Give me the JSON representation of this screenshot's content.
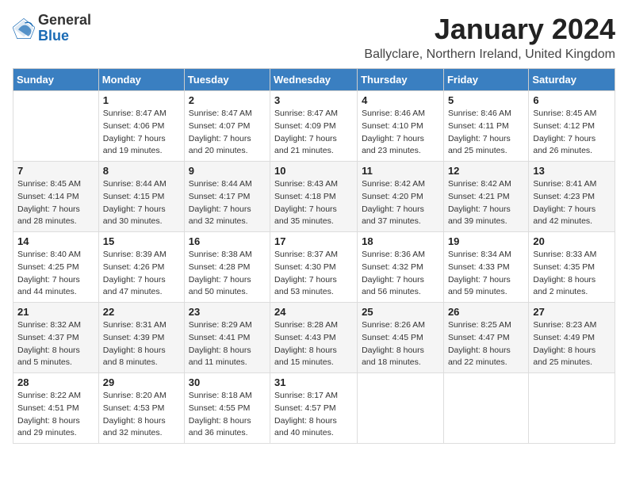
{
  "header": {
    "logo_general": "General",
    "logo_blue": "Blue",
    "month_title": "January 2024",
    "location": "Ballyclare, Northern Ireland, United Kingdom"
  },
  "weekdays": [
    "Sunday",
    "Monday",
    "Tuesday",
    "Wednesday",
    "Thursday",
    "Friday",
    "Saturday"
  ],
  "weeks": [
    [
      {
        "day": "",
        "info": ""
      },
      {
        "day": "1",
        "info": "Sunrise: 8:47 AM\nSunset: 4:06 PM\nDaylight: 7 hours\nand 19 minutes."
      },
      {
        "day": "2",
        "info": "Sunrise: 8:47 AM\nSunset: 4:07 PM\nDaylight: 7 hours\nand 20 minutes."
      },
      {
        "day": "3",
        "info": "Sunrise: 8:47 AM\nSunset: 4:09 PM\nDaylight: 7 hours\nand 21 minutes."
      },
      {
        "day": "4",
        "info": "Sunrise: 8:46 AM\nSunset: 4:10 PM\nDaylight: 7 hours\nand 23 minutes."
      },
      {
        "day": "5",
        "info": "Sunrise: 8:46 AM\nSunset: 4:11 PM\nDaylight: 7 hours\nand 25 minutes."
      },
      {
        "day": "6",
        "info": "Sunrise: 8:45 AM\nSunset: 4:12 PM\nDaylight: 7 hours\nand 26 minutes."
      }
    ],
    [
      {
        "day": "7",
        "info": "Sunrise: 8:45 AM\nSunset: 4:14 PM\nDaylight: 7 hours\nand 28 minutes."
      },
      {
        "day": "8",
        "info": "Sunrise: 8:44 AM\nSunset: 4:15 PM\nDaylight: 7 hours\nand 30 minutes."
      },
      {
        "day": "9",
        "info": "Sunrise: 8:44 AM\nSunset: 4:17 PM\nDaylight: 7 hours\nand 32 minutes."
      },
      {
        "day": "10",
        "info": "Sunrise: 8:43 AM\nSunset: 4:18 PM\nDaylight: 7 hours\nand 35 minutes."
      },
      {
        "day": "11",
        "info": "Sunrise: 8:42 AM\nSunset: 4:20 PM\nDaylight: 7 hours\nand 37 minutes."
      },
      {
        "day": "12",
        "info": "Sunrise: 8:42 AM\nSunset: 4:21 PM\nDaylight: 7 hours\nand 39 minutes."
      },
      {
        "day": "13",
        "info": "Sunrise: 8:41 AM\nSunset: 4:23 PM\nDaylight: 7 hours\nand 42 minutes."
      }
    ],
    [
      {
        "day": "14",
        "info": "Sunrise: 8:40 AM\nSunset: 4:25 PM\nDaylight: 7 hours\nand 44 minutes."
      },
      {
        "day": "15",
        "info": "Sunrise: 8:39 AM\nSunset: 4:26 PM\nDaylight: 7 hours\nand 47 minutes."
      },
      {
        "day": "16",
        "info": "Sunrise: 8:38 AM\nSunset: 4:28 PM\nDaylight: 7 hours\nand 50 minutes."
      },
      {
        "day": "17",
        "info": "Sunrise: 8:37 AM\nSunset: 4:30 PM\nDaylight: 7 hours\nand 53 minutes."
      },
      {
        "day": "18",
        "info": "Sunrise: 8:36 AM\nSunset: 4:32 PM\nDaylight: 7 hours\nand 56 minutes."
      },
      {
        "day": "19",
        "info": "Sunrise: 8:34 AM\nSunset: 4:33 PM\nDaylight: 7 hours\nand 59 minutes."
      },
      {
        "day": "20",
        "info": "Sunrise: 8:33 AM\nSunset: 4:35 PM\nDaylight: 8 hours\nand 2 minutes."
      }
    ],
    [
      {
        "day": "21",
        "info": "Sunrise: 8:32 AM\nSunset: 4:37 PM\nDaylight: 8 hours\nand 5 minutes."
      },
      {
        "day": "22",
        "info": "Sunrise: 8:31 AM\nSunset: 4:39 PM\nDaylight: 8 hours\nand 8 minutes."
      },
      {
        "day": "23",
        "info": "Sunrise: 8:29 AM\nSunset: 4:41 PM\nDaylight: 8 hours\nand 11 minutes."
      },
      {
        "day": "24",
        "info": "Sunrise: 8:28 AM\nSunset: 4:43 PM\nDaylight: 8 hours\nand 15 minutes."
      },
      {
        "day": "25",
        "info": "Sunrise: 8:26 AM\nSunset: 4:45 PM\nDaylight: 8 hours\nand 18 minutes."
      },
      {
        "day": "26",
        "info": "Sunrise: 8:25 AM\nSunset: 4:47 PM\nDaylight: 8 hours\nand 22 minutes."
      },
      {
        "day": "27",
        "info": "Sunrise: 8:23 AM\nSunset: 4:49 PM\nDaylight: 8 hours\nand 25 minutes."
      }
    ],
    [
      {
        "day": "28",
        "info": "Sunrise: 8:22 AM\nSunset: 4:51 PM\nDaylight: 8 hours\nand 29 minutes."
      },
      {
        "day": "29",
        "info": "Sunrise: 8:20 AM\nSunset: 4:53 PM\nDaylight: 8 hours\nand 32 minutes."
      },
      {
        "day": "30",
        "info": "Sunrise: 8:18 AM\nSunset: 4:55 PM\nDaylight: 8 hours\nand 36 minutes."
      },
      {
        "day": "31",
        "info": "Sunrise: 8:17 AM\nSunset: 4:57 PM\nDaylight: 8 hours\nand 40 minutes."
      },
      {
        "day": "",
        "info": ""
      },
      {
        "day": "",
        "info": ""
      },
      {
        "day": "",
        "info": ""
      }
    ]
  ]
}
